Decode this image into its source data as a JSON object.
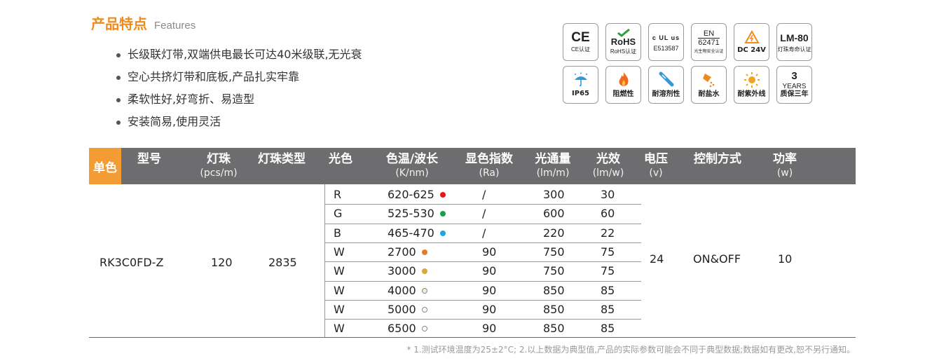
{
  "features": {
    "title_cn": "产品特点",
    "title_en": "Features",
    "items": [
      "长级联灯带,双端供电最长可达40米级联,无光衰",
      "空心共挤灯带和底板,产品扎实牢靠",
      "柔软性好,好弯折、易造型",
      "安装简易,使用灵活"
    ]
  },
  "badges": {
    "ce": {
      "mark": "CE",
      "caption": "CE认证"
    },
    "rohs": {
      "mark": "RoHS",
      "caption": "RoHS认证"
    },
    "ul": {
      "mark": "c UL us",
      "caption": "E513587"
    },
    "en": {
      "mark": "EN",
      "sub": "62471",
      "caption": "光生物安全认证"
    },
    "dc": {
      "caption": "DC 24V"
    },
    "lm": {
      "mark": "LM-80",
      "caption": "灯珠寿命认证"
    },
    "ip": {
      "caption": "IP65"
    },
    "fire": {
      "caption": "阻燃性"
    },
    "solvent": {
      "caption": "耐溶剂性"
    },
    "salt": {
      "caption": "耐盐水"
    },
    "uv": {
      "caption": "耐紫外线"
    },
    "warranty": {
      "num": "3",
      "unit": "YEARS",
      "caption": "质保三年"
    }
  },
  "table": {
    "tag": "单色",
    "headers": {
      "model": "型号",
      "leds": "灯珠",
      "leds_unit": "(pcs/m)",
      "led_type": "灯珠类型",
      "color": "光色",
      "cct": "色温/波长",
      "cct_unit": "(K/nm)",
      "cri": "显色指数",
      "cri_unit": "(Ra)",
      "flux": "光通量",
      "flux_unit": "(lm/m)",
      "eff": "光效",
      "eff_unit": "(lm/w)",
      "voltage": "电压",
      "voltage_unit": "(v)",
      "control": "控制方式",
      "power": "功率",
      "power_unit": "(w)"
    },
    "model": "RK3C0FD-Z",
    "leds": "120",
    "led_type": "2835",
    "voltage": "24",
    "control": "ON&OFF",
    "power": "10",
    "rows": [
      {
        "color": "R",
        "cct": "620-625",
        "cri": "/",
        "flux": "300",
        "eff": "30",
        "dot": "#e8141b"
      },
      {
        "color": "G",
        "cct": "525-530",
        "cri": "/",
        "flux": "600",
        "eff": "60",
        "dot": "#16a04a"
      },
      {
        "color": "B",
        "cct": "465-470",
        "cri": "/",
        "flux": "220",
        "eff": "22",
        "dot": "#1ea6e0"
      },
      {
        "color": "W",
        "cct": "2700",
        "cri": "90",
        "flux": "750",
        "eff": "75",
        "dot": "#e07d2c"
      },
      {
        "color": "W",
        "cct": "3000",
        "cri": "90",
        "flux": "750",
        "eff": "75",
        "dot": "#d9a73a"
      },
      {
        "color": "W",
        "cct": "4000",
        "cri": "90",
        "flux": "850",
        "eff": "85",
        "dot": "#f3efd2"
      },
      {
        "color": "W",
        "cct": "5000",
        "cri": "90",
        "flux": "850",
        "eff": "85",
        "dot": "#ffffff"
      },
      {
        "color": "W",
        "cct": "6500",
        "cri": "90",
        "flux": "850",
        "eff": "85",
        "dot": "#ffffff"
      }
    ]
  },
  "footnote": "* 1.测试环境温度为25±2°C; 2.以上数据为典型值,产品的实际参数可能会不同于典型数据;数据如有更改,恕不另行通知。"
}
